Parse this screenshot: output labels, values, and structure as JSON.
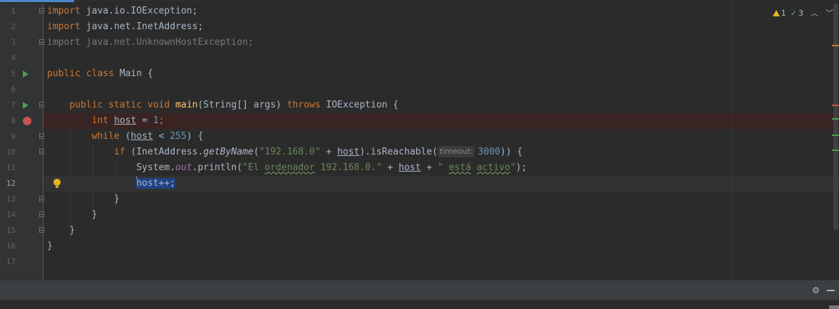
{
  "inspections": {
    "warnings_count": "1",
    "weak_warnings_count": "3"
  },
  "editor": {
    "line_numbers": [
      "1",
      "2",
      "3",
      "4",
      "5",
      "6",
      "7",
      "8",
      "9",
      "10",
      "11",
      "12",
      "13",
      "14",
      "15",
      "16",
      "17"
    ],
    "current_line": 12,
    "param_hint": "timeout:",
    "lines": {
      "l1": [
        "import",
        " java.io.IOException;"
      ],
      "l2": [
        "import",
        " java.net.InetAddress;"
      ],
      "l3": [
        "import java.net.UnknownHostException;"
      ],
      "l5": [
        "public",
        " ",
        "class",
        " Main {"
      ],
      "l7": [
        "public",
        " ",
        "static",
        " ",
        "void",
        " ",
        "main",
        "(String[] args) ",
        "throws",
        " IOException {"
      ],
      "l8": [
        "int",
        " ",
        "host",
        " = ",
        "1",
        ";"
      ],
      "l9": [
        "while",
        " (",
        "host",
        " < ",
        "255",
        ") {"
      ],
      "l10": [
        "if",
        " (InetAddress.",
        "getByName",
        "(",
        "\"192.168.0\"",
        " + ",
        "host",
        ").isReachable(",
        "3000",
        ")) {"
      ],
      "l11": [
        "System.",
        "out",
        ".println(",
        "\"El ",
        "ordenador",
        " 192.168.0.\"",
        " + ",
        "host",
        " + ",
        "\" ",
        "está",
        " ",
        "activo",
        "\"",
        ");"
      ],
      "l12": [
        "host++;"
      ],
      "l13": [
        "}"
      ],
      "l14": [
        "}"
      ],
      "l15": [
        "}"
      ],
      "l16": [
        "}"
      ]
    }
  },
  "colors": {
    "background": "#2b2b2b",
    "gutter": "#313335",
    "keyword": "#cc7832",
    "string": "#6a8759",
    "number": "#6897bb",
    "method": "#ffc66d",
    "field": "#9876aa",
    "breakpoint": "#c75450",
    "run_icon": "#499c54",
    "selection": "#214283"
  },
  "icons": {
    "run": "run-icon",
    "breakpoint": "breakpoint-icon",
    "fold": "fold-icon",
    "bulb": "bulb-icon",
    "warning": "warning-icon",
    "check": "check-icon",
    "gear": "gear-icon",
    "hide": "hide-icon"
  }
}
